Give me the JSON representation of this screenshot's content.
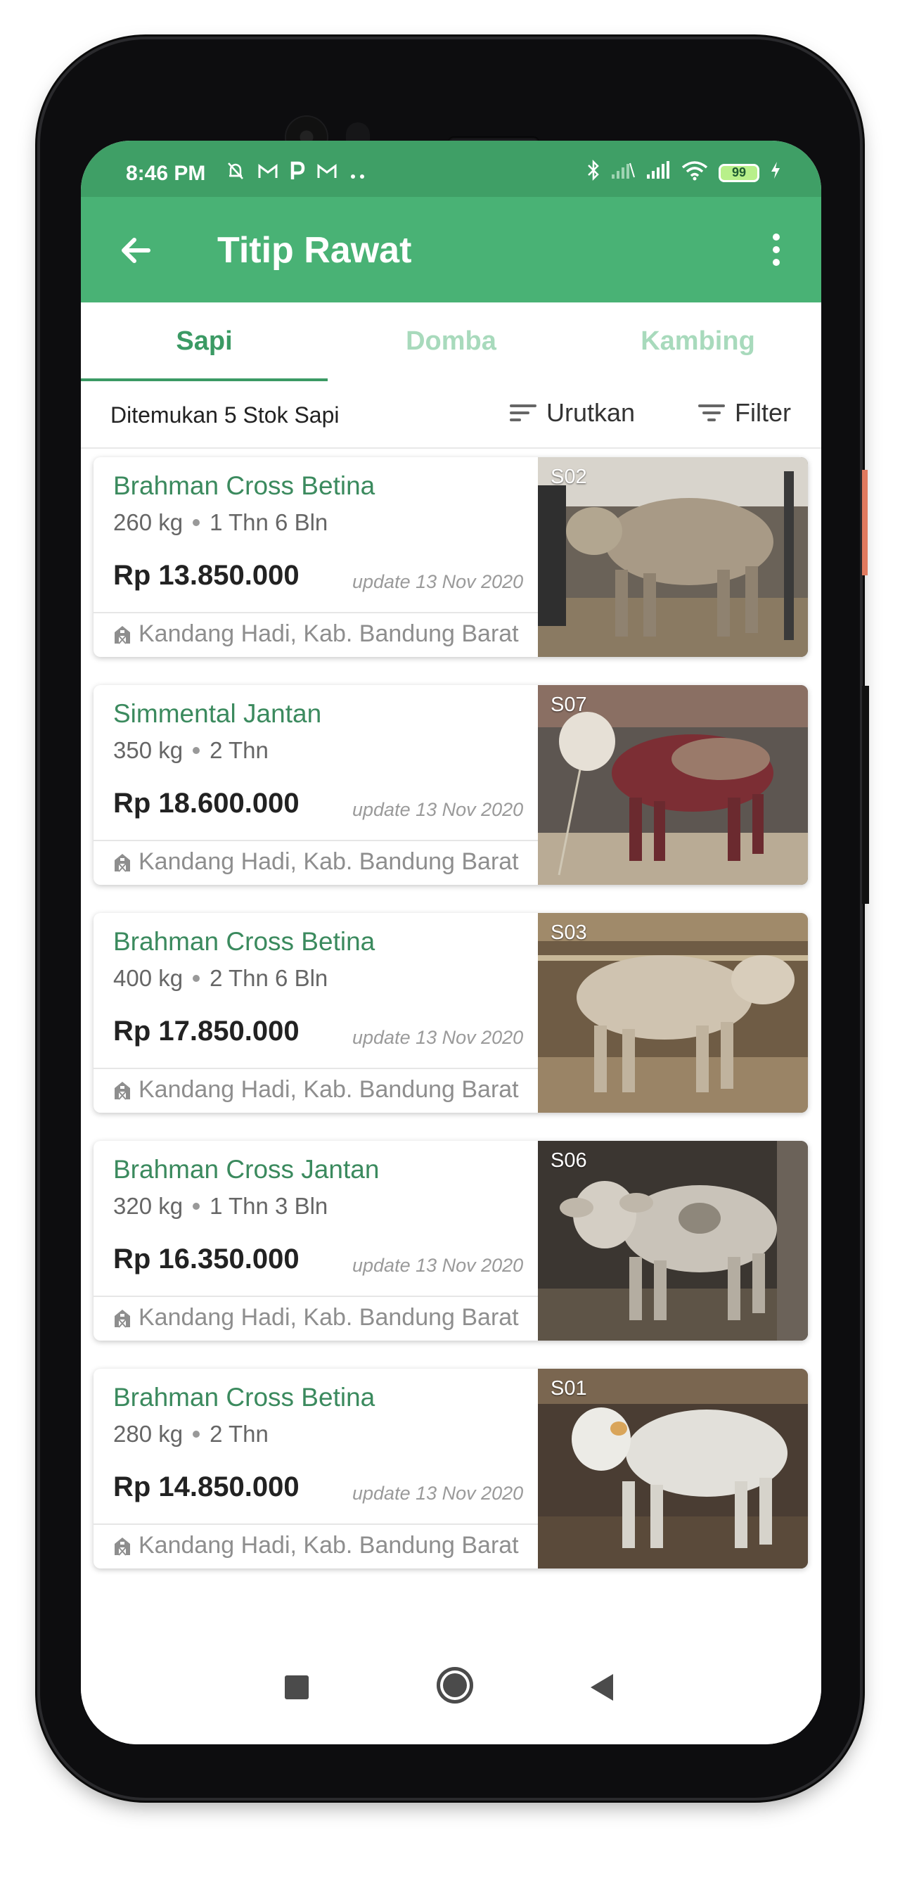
{
  "status_bar": {
    "time": "8:46 PM",
    "battery": "99",
    "icons_left": [
      "mute-bell-icon",
      "gmail-icon",
      "parking-icon",
      "gmail-icon",
      "more-dots-icon"
    ],
    "icons_right": [
      "bluetooth-icon",
      "signal-icon",
      "signal-icon",
      "wifi-icon",
      "battery-icon",
      "charging-icon"
    ]
  },
  "app_bar": {
    "title": "Titip Rawat",
    "back_icon": "back-arrow-icon",
    "menu_icon": "overflow-menu-icon"
  },
  "tabs": [
    {
      "label": "Sapi",
      "active": true
    },
    {
      "label": "Domba",
      "active": false
    },
    {
      "label": "Kambing",
      "active": false
    }
  ],
  "toolbar": {
    "found_text": "Ditemukan 5 Stok Sapi",
    "sort_label": "Urutkan",
    "filter_label": "Filter"
  },
  "listings": [
    {
      "name": "Brahman Cross Betina",
      "weight": "260 kg",
      "age": "1 Thn 6 Bln",
      "price": "Rp 13.850.000",
      "update": "update 13 Nov 2020",
      "location": "Kandang Hadi, Kab. Bandung Barat",
      "code": "S02"
    },
    {
      "name": "Simmental Jantan",
      "weight": "350 kg",
      "age": "2 Thn",
      "price": "Rp 18.600.000",
      "update": "update 13 Nov 2020",
      "location": "Kandang Hadi, Kab. Bandung Barat",
      "code": "S07"
    },
    {
      "name": "Brahman Cross Betina",
      "weight": "400 kg",
      "age": "2 Thn 6 Bln",
      "price": "Rp 17.850.000",
      "update": "update 13 Nov 2020",
      "location": "Kandang Hadi, Kab. Bandung Barat",
      "code": "S03"
    },
    {
      "name": "Brahman Cross Jantan",
      "weight": "320 kg",
      "age": "1 Thn 3 Bln",
      "price": "Rp 16.350.000",
      "update": "update 13 Nov 2020",
      "location": "Kandang Hadi, Kab. Bandung Barat",
      "code": "S06"
    },
    {
      "name": "Brahman Cross Betina",
      "weight": "280 kg",
      "age": "2 Thn",
      "price": "Rp 14.850.000",
      "update": "update 13 Nov 2020",
      "location": "Kandang Hadi, Kab. Bandung Barat",
      "code": "S01"
    }
  ],
  "colors": {
    "status_bar": "#3f9f66",
    "app_bar": "#49b275",
    "accent": "#3b9a64",
    "tab_inactive": "#a8dabc"
  }
}
